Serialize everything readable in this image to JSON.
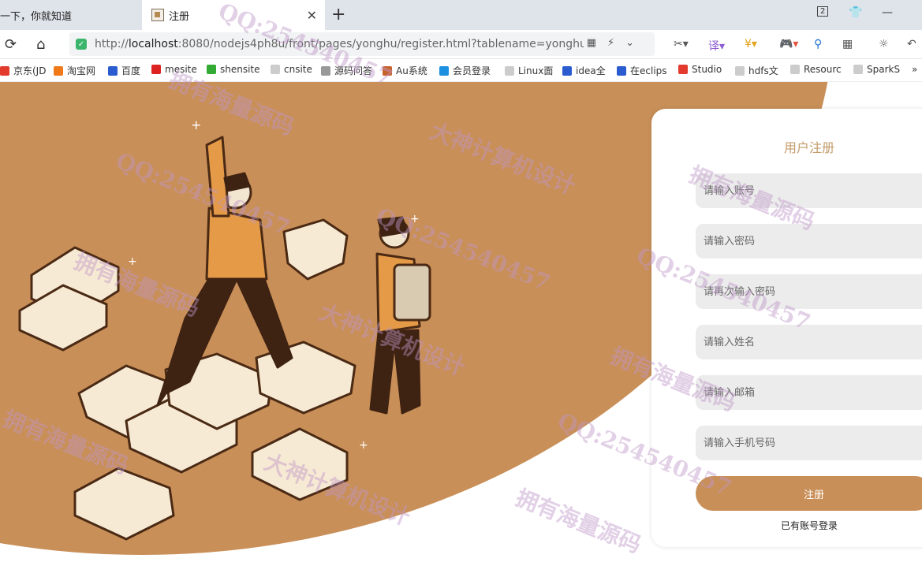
{
  "browser": {
    "tab_inactive_label": "一下，你就知道",
    "tab_active_label": "注册",
    "url_scheme": "http://",
    "url_host": "localhost",
    "url_rest": ":8080/nodejs4ph8u/front/pages/yonghu/register.html?tablename=yonghu",
    "bookmarks": [
      "京东(JD",
      "淘宝网",
      "百度",
      "mesite",
      "shensite",
      "cnsite",
      "源码问答",
      "Au系统",
      "会员登录",
      "Linux面",
      "idea全",
      "在eclips",
      "Studio",
      "hdfs文",
      "Resourc",
      "SparkS"
    ],
    "bookmark_colors": [
      "#e23b2e",
      "#f07a1a",
      "#2b5ccf",
      "#d22",
      "#3a3",
      "#888",
      "#999",
      "#c8612a",
      "#1d8fe0",
      "#888",
      "#2b5ccf",
      "#2b5ccf",
      "#e23b2e",
      "#888",
      "#888",
      "#888"
    ]
  },
  "register": {
    "title": "用户注册",
    "fields": [
      {
        "name": "account-input",
        "placeholder": "请输入账号"
      },
      {
        "name": "password-input",
        "placeholder": "请输入密码"
      },
      {
        "name": "password-confirm-input",
        "placeholder": "请再次输入密码"
      },
      {
        "name": "name-input",
        "placeholder": "请输入姓名"
      },
      {
        "name": "email-input",
        "placeholder": "请输入邮箱"
      },
      {
        "name": "phone-input",
        "placeholder": "请输入手机号码"
      }
    ],
    "submit_label": "注册",
    "login_link": "已有账号登录"
  },
  "watermarks": [
    "QQ:254540457",
    "拥有海量源码",
    "大神计算机设计"
  ],
  "colors": {
    "accent": "#c98f58",
    "title": "#c49b6a",
    "field_bg": "#ececec"
  }
}
